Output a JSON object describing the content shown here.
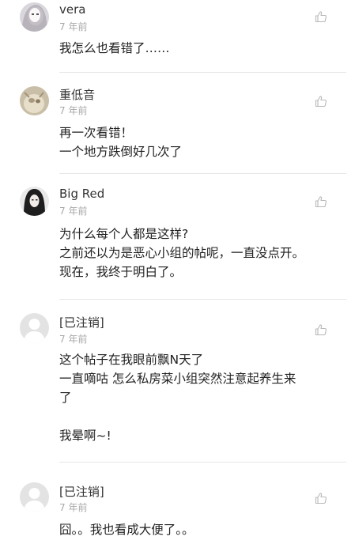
{
  "comments": [
    {
      "username": "vera",
      "time": "7 年前",
      "lines": [
        "我怎么也看错了……"
      ],
      "avatar_icon": "avatar-photo-icon",
      "like_icon": "thumbs-up-icon"
    },
    {
      "username": "重低音",
      "time": "7 年前",
      "lines": [
        "再一次看错！",
        "一个地方跌倒好几次了"
      ],
      "avatar_icon": "avatar-photo-icon",
      "like_icon": "thumbs-up-icon"
    },
    {
      "username": "Big Red",
      "time": "7 年前",
      "lines": [
        "为什么每个人都是这样?",
        "之前还以为是恶心小组的帖呢，一直没点开。",
        "现在，我终于明白了。"
      ],
      "avatar_icon": "avatar-photo-icon",
      "like_icon": "thumbs-up-icon"
    },
    {
      "username": "[已注销]",
      "time": "7 年前",
      "lines": [
        "这个帖子在我眼前飘N天了",
        "一直嘀咕 怎么私房菜小组突然注意起养生来",
        "了",
        "",
        "我晕啊~!"
      ],
      "avatar_icon": "default-avatar-icon",
      "like_icon": "thumbs-up-icon"
    },
    {
      "username": "[已注销]",
      "time": "7 年前",
      "lines": [
        "囧。。我也看成大便了。。"
      ],
      "avatar_icon": "default-avatar-icon",
      "like_icon": "thumbs-up-icon"
    }
  ]
}
